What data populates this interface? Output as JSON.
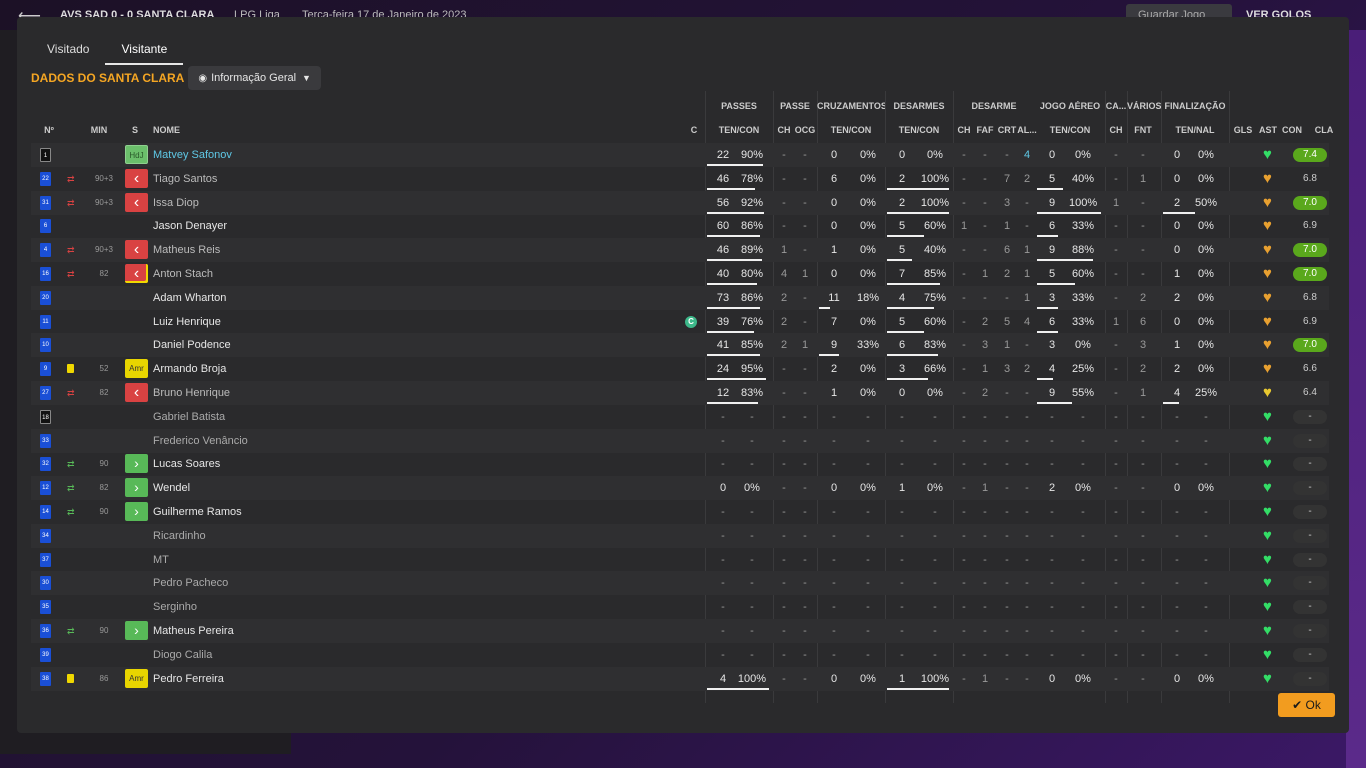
{
  "topbar": {
    "score": "AVS SAD 0 - 0 SANTA CLARA",
    "league": "LPG Liga",
    "date": "Terça-feira 17 de Janeiro de 2023",
    "save": "Guardar Jogo",
    "goals": "VER GOLOS"
  },
  "tabs": [
    {
      "label": "Visitado"
    },
    {
      "label": "Visitante"
    }
  ],
  "team_title": "DADOS DO SANTA CLARA",
  "view_dropdown": "Informação Geral",
  "ok_label": "Ok",
  "colors": {
    "accent": "#f5a623",
    "rating_good": "#5aa81c",
    "heart_green": "#33dd66",
    "heart_orange": "#e8a030",
    "sub_out": "#d94242",
    "sub_in": "#58b958"
  },
  "group_headers": {
    "passes": "PASSES",
    "passe": "PASSE",
    "cruzamentos": "CRUZAMENTOS",
    "desarmes": "DESARMES",
    "desarme": "DESARME",
    "jogo_aereo": "JOGO AÉREO",
    "ca": "CA...",
    "varios": "VÁRIOS",
    "finalizacao": "FINALIZAÇÃO"
  },
  "col_headers": {
    "num": "Nº",
    "min": "MIN",
    "s": "S",
    "nome": "NOME",
    "c": "C",
    "p_tc": "TEN/CON",
    "pa_ch": "CH",
    "pa_ocg": "OCG",
    "cr_tc": "TEN/CON",
    "de_tc": "TEN/CON",
    "d_ch": "CH",
    "d_faf": "FAF",
    "d_crt": "CRT",
    "d_al": "AL...",
    "ja_tc": "TEN/CON",
    "ca_ch": "CH",
    "va_fnt": "FNT",
    "fi_tn": "TEN/NAL",
    "gls": "GLS",
    "ast": "AST",
    "con": "CON",
    "cla": "CLA"
  },
  "players": [
    {
      "num": "1",
      "gk": true,
      "min": "",
      "sub": "",
      "pos": "HdJ",
      "name": "Matvey Safonov",
      "state": "active",
      "card": false,
      "captain": false,
      "p_t": "22",
      "p_c": "90%",
      "p_bar": 0.9,
      "pa_ch": "-",
      "pa_ocg": "-",
      "cr_t": "0",
      "cr_c": "0%",
      "cr_bar": 0,
      "de_t": "0",
      "de_c": "0%",
      "de_bar": 0,
      "d_ch": "-",
      "d_faf": "-",
      "d_crt": "-",
      "d_al": "4",
      "ja_t": "0",
      "ja_c": "0%",
      "ja_bar": 0,
      "ca_ch": "-",
      "va_fnt": "-",
      "fi_t": "0",
      "fi_c": "0%",
      "fi_bar": 0,
      "gls": "-",
      "ast": "",
      "heart": "green",
      "rating": "7.4",
      "rating_good": true
    },
    {
      "num": "22",
      "gk": false,
      "min": "90+3",
      "sub": "out",
      "pos": "out",
      "name": "Tiago Santos",
      "state": "sub",
      "card": false,
      "captain": false,
      "p_t": "46",
      "p_c": "78%",
      "p_bar": 0.78,
      "pa_ch": "-",
      "pa_ocg": "-",
      "cr_t": "6",
      "cr_c": "0%",
      "cr_bar": 0,
      "de_t": "2",
      "de_c": "100%",
      "de_bar": 1,
      "d_ch": "-",
      "d_faf": "-",
      "d_crt": "7",
      "d_al": "2",
      "ja_t": "5",
      "ja_c": "40%",
      "ja_bar": 0.4,
      "ca_ch": "-",
      "va_fnt": "1",
      "fi_t": "0",
      "fi_c": "0%",
      "fi_bar": 0,
      "gls": "-",
      "ast": "",
      "heart": "orange",
      "rating": "6.8",
      "rating_good": false
    },
    {
      "num": "31",
      "gk": false,
      "min": "90+3",
      "sub": "out",
      "pos": "out",
      "name": "Issa Diop",
      "state": "sub",
      "card": false,
      "captain": false,
      "p_t": "56",
      "p_c": "92%",
      "p_bar": 0.92,
      "pa_ch": "-",
      "pa_ocg": "-",
      "cr_t": "0",
      "cr_c": "0%",
      "cr_bar": 0,
      "de_t": "2",
      "de_c": "100%",
      "de_bar": 1,
      "d_ch": "-",
      "d_faf": "-",
      "d_crt": "3",
      "d_al": "-",
      "ja_t": "9",
      "ja_c": "100%",
      "ja_bar": 1,
      "ca_ch": "1",
      "va_fnt": "-",
      "fi_t": "2",
      "fi_c": "50%",
      "fi_bar": 0.5,
      "gls": "-",
      "ast": "",
      "heart": "orange",
      "rating": "7.0",
      "rating_good": true
    },
    {
      "num": "6",
      "gk": false,
      "min": "",
      "sub": "",
      "pos": "",
      "name": "Jason Denayer",
      "state": "normal",
      "card": false,
      "captain": false,
      "p_t": "60",
      "p_c": "86%",
      "p_bar": 0.86,
      "pa_ch": "-",
      "pa_ocg": "-",
      "cr_t": "0",
      "cr_c": "0%",
      "cr_bar": 0,
      "de_t": "5",
      "de_c": "60%",
      "de_bar": 0.6,
      "d_ch": "1",
      "d_faf": "-",
      "d_crt": "1",
      "d_al": "-",
      "ja_t": "6",
      "ja_c": "33%",
      "ja_bar": 0.33,
      "ca_ch": "-",
      "va_fnt": "-",
      "fi_t": "0",
      "fi_c": "0%",
      "fi_bar": 0,
      "gls": "-",
      "ast": "",
      "heart": "orange",
      "rating": "6.9",
      "rating_good": false
    },
    {
      "num": "4",
      "gk": false,
      "min": "90+3",
      "sub": "out",
      "pos": "out",
      "name": "Matheus Reis",
      "state": "sub",
      "card": false,
      "captain": false,
      "p_t": "46",
      "p_c": "89%",
      "p_bar": 0.89,
      "pa_ch": "1",
      "pa_ocg": "-",
      "cr_t": "1",
      "cr_c": "0%",
      "cr_bar": 0,
      "de_t": "5",
      "de_c": "40%",
      "de_bar": 0.4,
      "d_ch": "-",
      "d_faf": "-",
      "d_crt": "6",
      "d_al": "1",
      "ja_t": "9",
      "ja_c": "88%",
      "ja_bar": 0.88,
      "ca_ch": "-",
      "va_fnt": "-",
      "fi_t": "0",
      "fi_c": "0%",
      "fi_bar": 0,
      "gls": "-",
      "ast": "",
      "heart": "orange",
      "rating": "7.0",
      "rating_good": true
    },
    {
      "num": "16",
      "gk": false,
      "min": "82",
      "sub": "out",
      "pos": "out",
      "name": "Anton Stach",
      "state": "sub",
      "card": true,
      "captain": false,
      "p_t": "40",
      "p_c": "80%",
      "p_bar": 0.8,
      "pa_ch": "4",
      "pa_ocg": "1",
      "cr_t": "0",
      "cr_c": "0%",
      "cr_bar": 0,
      "de_t": "7",
      "de_c": "85%",
      "de_bar": 0.85,
      "d_ch": "-",
      "d_faf": "1",
      "d_crt": "2",
      "d_al": "1",
      "ja_t": "5",
      "ja_c": "60%",
      "ja_bar": 0.6,
      "ca_ch": "-",
      "va_fnt": "-",
      "fi_t": "1",
      "fi_c": "0%",
      "fi_bar": 0,
      "gls": "-",
      "ast": "",
      "heart": "orange",
      "rating": "7.0",
      "rating_good": true
    },
    {
      "num": "20",
      "gk": false,
      "min": "",
      "sub": "",
      "pos": "",
      "name": "Adam Wharton",
      "state": "normal",
      "card": false,
      "captain": false,
      "p_t": "73",
      "p_c": "86%",
      "p_bar": 0.86,
      "pa_ch": "2",
      "pa_ocg": "-",
      "cr_t": "11",
      "cr_c": "18%",
      "cr_bar": 0.18,
      "de_t": "4",
      "de_c": "75%",
      "de_bar": 0.75,
      "d_ch": "-",
      "d_faf": "-",
      "d_crt": "-",
      "d_al": "1",
      "ja_t": "3",
      "ja_c": "33%",
      "ja_bar": 0.33,
      "ca_ch": "-",
      "va_fnt": "2",
      "fi_t": "2",
      "fi_c": "0%",
      "fi_bar": 0,
      "gls": "-",
      "ast": "",
      "heart": "orange",
      "rating": "6.8",
      "rating_good": false
    },
    {
      "num": "11",
      "gk": false,
      "min": "",
      "sub": "",
      "pos": "",
      "name": "Luiz Henrique",
      "state": "normal",
      "card": false,
      "captain": true,
      "p_t": "39",
      "p_c": "76%",
      "p_bar": 0.76,
      "pa_ch": "2",
      "pa_ocg": "-",
      "cr_t": "7",
      "cr_c": "0%",
      "cr_bar": 0,
      "de_t": "5",
      "de_c": "60%",
      "de_bar": 0.6,
      "d_ch": "-",
      "d_faf": "2",
      "d_crt": "5",
      "d_al": "4",
      "ja_t": "6",
      "ja_c": "33%",
      "ja_bar": 0.33,
      "ca_ch": "1",
      "va_fnt": "6",
      "fi_t": "0",
      "fi_c": "0%",
      "fi_bar": 0,
      "gls": "-",
      "ast": "",
      "heart": "orange",
      "rating": "6.9",
      "rating_good": false
    },
    {
      "num": "10",
      "gk": false,
      "min": "",
      "sub": "",
      "pos": "",
      "name": "Daniel Podence",
      "state": "normal",
      "card": false,
      "captain": false,
      "p_t": "41",
      "p_c": "85%",
      "p_bar": 0.85,
      "pa_ch": "2",
      "pa_ocg": "1",
      "cr_t": "9",
      "cr_c": "33%",
      "cr_bar": 0.33,
      "de_t": "6",
      "de_c": "83%",
      "de_bar": 0.83,
      "d_ch": "-",
      "d_faf": "3",
      "d_crt": "1",
      "d_al": "-",
      "ja_t": "3",
      "ja_c": "0%",
      "ja_bar": 0,
      "ca_ch": "-",
      "va_fnt": "3",
      "fi_t": "1",
      "fi_c": "0%",
      "fi_bar": 0,
      "gls": "-",
      "ast": "",
      "heart": "orange",
      "rating": "7.0",
      "rating_good": true
    },
    {
      "num": "9",
      "gk": false,
      "min": "52",
      "sub": "card",
      "pos": "amr",
      "name": "Armando Broja",
      "state": "normal",
      "card": false,
      "captain": false,
      "p_t": "24",
      "p_c": "95%",
      "p_bar": 0.95,
      "pa_ch": "-",
      "pa_ocg": "-",
      "cr_t": "2",
      "cr_c": "0%",
      "cr_bar": 0,
      "de_t": "3",
      "de_c": "66%",
      "de_bar": 0.66,
      "d_ch": "-",
      "d_faf": "1",
      "d_crt": "3",
      "d_al": "2",
      "ja_t": "4",
      "ja_c": "25%",
      "ja_bar": 0.25,
      "ca_ch": "-",
      "va_fnt": "2",
      "fi_t": "2",
      "fi_c": "0%",
      "fi_bar": 0,
      "gls": "-",
      "ast": "",
      "heart": "orange",
      "rating": "6.6",
      "rating_good": false
    },
    {
      "num": "27",
      "gk": false,
      "min": "82",
      "sub": "out",
      "pos": "out",
      "name": "Bruno Henrique",
      "state": "sub",
      "card": false,
      "captain": false,
      "p_t": "12",
      "p_c": "83%",
      "p_bar": 0.83,
      "pa_ch": "-",
      "pa_ocg": "-",
      "cr_t": "1",
      "cr_c": "0%",
      "cr_bar": 0,
      "de_t": "0",
      "de_c": "0%",
      "de_bar": 0,
      "d_ch": "-",
      "d_faf": "2",
      "d_crt": "-",
      "d_al": "-",
      "ja_t": "9",
      "ja_c": "55%",
      "ja_bar": 0.55,
      "ca_ch": "-",
      "va_fnt": "1",
      "fi_t": "4",
      "fi_c": "25%",
      "fi_bar": 0.25,
      "gls": "-",
      "ast": "",
      "heart": "yellow",
      "rating": "6.4",
      "rating_good": false
    },
    {
      "num": "18",
      "gk": true,
      "min": "",
      "sub": "",
      "pos": "",
      "name": "Gabriel Batista",
      "state": "unused",
      "card": false,
      "captain": false,
      "p_t": "-",
      "p_c": "-",
      "p_bar": 0,
      "pa_ch": "-",
      "pa_ocg": "-",
      "cr_t": "-",
      "cr_c": "-",
      "cr_bar": 0,
      "de_t": "-",
      "de_c": "-",
      "de_bar": 0,
      "d_ch": "-",
      "d_faf": "-",
      "d_crt": "-",
      "d_al": "-",
      "ja_t": "-",
      "ja_c": "-",
      "ja_bar": 0,
      "ca_ch": "-",
      "va_fnt": "-",
      "fi_t": "-",
      "fi_c": "-",
      "fi_bar": 0,
      "gls": "-",
      "ast": "",
      "heart": "green",
      "rating": "-",
      "rating_good": false
    },
    {
      "num": "33",
      "gk": false,
      "min": "",
      "sub": "",
      "pos": "",
      "name": "Frederico Venâncio",
      "state": "unused",
      "card": false,
      "captain": false,
      "p_t": "-",
      "p_c": "-",
      "p_bar": 0,
      "pa_ch": "-",
      "pa_ocg": "-",
      "cr_t": "-",
      "cr_c": "-",
      "cr_bar": 0,
      "de_t": "-",
      "de_c": "-",
      "de_bar": 0,
      "d_ch": "-",
      "d_faf": "-",
      "d_crt": "-",
      "d_al": "-",
      "ja_t": "-",
      "ja_c": "-",
      "ja_bar": 0,
      "ca_ch": "-",
      "va_fnt": "-",
      "fi_t": "-",
      "fi_c": "-",
      "fi_bar": 0,
      "gls": "-",
      "ast": "",
      "heart": "green",
      "rating": "-",
      "rating_good": false
    },
    {
      "num": "32",
      "gk": false,
      "min": "90",
      "sub": "in",
      "pos": "in",
      "name": "Lucas Soares",
      "state": "normal",
      "card": false,
      "captain": false,
      "p_t": "-",
      "p_c": "-",
      "p_bar": 0,
      "pa_ch": "-",
      "pa_ocg": "-",
      "cr_t": "-",
      "cr_c": "-",
      "cr_bar": 0,
      "de_t": "-",
      "de_c": "-",
      "de_bar": 0,
      "d_ch": "-",
      "d_faf": "-",
      "d_crt": "-",
      "d_al": "-",
      "ja_t": "-",
      "ja_c": "-",
      "ja_bar": 0,
      "ca_ch": "-",
      "va_fnt": "-",
      "fi_t": "-",
      "fi_c": "-",
      "fi_bar": 0,
      "gls": "-",
      "ast": "",
      "heart": "green",
      "rating": "-",
      "rating_good": false
    },
    {
      "num": "12",
      "gk": false,
      "min": "82",
      "sub": "in",
      "pos": "in",
      "name": "Wendel",
      "state": "normal",
      "card": false,
      "captain": false,
      "p_t": "0",
      "p_c": "0%",
      "p_bar": 0,
      "pa_ch": "-",
      "pa_ocg": "-",
      "cr_t": "0",
      "cr_c": "0%",
      "cr_bar": 0,
      "de_t": "1",
      "de_c": "0%",
      "de_bar": 0,
      "d_ch": "-",
      "d_faf": "1",
      "d_crt": "-",
      "d_al": "-",
      "ja_t": "2",
      "ja_c": "0%",
      "ja_bar": 0,
      "ca_ch": "-",
      "va_fnt": "-",
      "fi_t": "0",
      "fi_c": "0%",
      "fi_bar": 0,
      "gls": "-",
      "ast": "",
      "heart": "green",
      "rating": "-",
      "rating_good": false
    },
    {
      "num": "14",
      "gk": false,
      "min": "90",
      "sub": "in",
      "pos": "in",
      "name": "Guilherme Ramos",
      "state": "normal",
      "card": false,
      "captain": false,
      "p_t": "-",
      "p_c": "-",
      "p_bar": 0,
      "pa_ch": "-",
      "pa_ocg": "-",
      "cr_t": "-",
      "cr_c": "-",
      "cr_bar": 0,
      "de_t": "-",
      "de_c": "-",
      "de_bar": 0,
      "d_ch": "-",
      "d_faf": "-",
      "d_crt": "-",
      "d_al": "-",
      "ja_t": "-",
      "ja_c": "-",
      "ja_bar": 0,
      "ca_ch": "-",
      "va_fnt": "-",
      "fi_t": "-",
      "fi_c": "-",
      "fi_bar": 0,
      "gls": "-",
      "ast": "",
      "heart": "green",
      "rating": "-",
      "rating_good": false
    },
    {
      "num": "34",
      "gk": false,
      "min": "",
      "sub": "",
      "pos": "",
      "name": "Ricardinho",
      "state": "unused",
      "card": false,
      "captain": false,
      "p_t": "-",
      "p_c": "-",
      "p_bar": 0,
      "pa_ch": "-",
      "pa_ocg": "-",
      "cr_t": "-",
      "cr_c": "-",
      "cr_bar": 0,
      "de_t": "-",
      "de_c": "-",
      "de_bar": 0,
      "d_ch": "-",
      "d_faf": "-",
      "d_crt": "-",
      "d_al": "-",
      "ja_t": "-",
      "ja_c": "-",
      "ja_bar": 0,
      "ca_ch": "-",
      "va_fnt": "-",
      "fi_t": "-",
      "fi_c": "-",
      "fi_bar": 0,
      "gls": "-",
      "ast": "",
      "heart": "green",
      "rating": "-",
      "rating_good": false
    },
    {
      "num": "37",
      "gk": false,
      "min": "",
      "sub": "",
      "pos": "",
      "name": "MT",
      "state": "unused",
      "card": false,
      "captain": false,
      "p_t": "-",
      "p_c": "-",
      "p_bar": 0,
      "pa_ch": "-",
      "pa_ocg": "-",
      "cr_t": "-",
      "cr_c": "-",
      "cr_bar": 0,
      "de_t": "-",
      "de_c": "-",
      "de_bar": 0,
      "d_ch": "-",
      "d_faf": "-",
      "d_crt": "-",
      "d_al": "-",
      "ja_t": "-",
      "ja_c": "-",
      "ja_bar": 0,
      "ca_ch": "-",
      "va_fnt": "-",
      "fi_t": "-",
      "fi_c": "-",
      "fi_bar": 0,
      "gls": "-",
      "ast": "",
      "heart": "green",
      "rating": "-",
      "rating_good": false
    },
    {
      "num": "30",
      "gk": false,
      "min": "",
      "sub": "",
      "pos": "",
      "name": "Pedro Pacheco",
      "state": "unused",
      "card": false,
      "captain": false,
      "p_t": "-",
      "p_c": "-",
      "p_bar": 0,
      "pa_ch": "-",
      "pa_ocg": "-",
      "cr_t": "-",
      "cr_c": "-",
      "cr_bar": 0,
      "de_t": "-",
      "de_c": "-",
      "de_bar": 0,
      "d_ch": "-",
      "d_faf": "-",
      "d_crt": "-",
      "d_al": "-",
      "ja_t": "-",
      "ja_c": "-",
      "ja_bar": 0,
      "ca_ch": "-",
      "va_fnt": "-",
      "fi_t": "-",
      "fi_c": "-",
      "fi_bar": 0,
      "gls": "-",
      "ast": "",
      "heart": "green",
      "rating": "-",
      "rating_good": false
    },
    {
      "num": "35",
      "gk": false,
      "min": "",
      "sub": "",
      "pos": "",
      "name": "Serginho",
      "state": "unused",
      "card": false,
      "captain": false,
      "p_t": "-",
      "p_c": "-",
      "p_bar": 0,
      "pa_ch": "-",
      "pa_ocg": "-",
      "cr_t": "-",
      "cr_c": "-",
      "cr_bar": 0,
      "de_t": "-",
      "de_c": "-",
      "de_bar": 0,
      "d_ch": "-",
      "d_faf": "-",
      "d_crt": "-",
      "d_al": "-",
      "ja_t": "-",
      "ja_c": "-",
      "ja_bar": 0,
      "ca_ch": "-",
      "va_fnt": "-",
      "fi_t": "-",
      "fi_c": "-",
      "fi_bar": 0,
      "gls": "-",
      "ast": "",
      "heart": "green",
      "rating": "-",
      "rating_good": false
    },
    {
      "num": "36",
      "gk": false,
      "min": "90",
      "sub": "in",
      "pos": "in",
      "name": "Matheus Pereira",
      "state": "normal",
      "card": false,
      "captain": false,
      "p_t": "-",
      "p_c": "-",
      "p_bar": 0,
      "pa_ch": "-",
      "pa_ocg": "-",
      "cr_t": "-",
      "cr_c": "-",
      "cr_bar": 0,
      "de_t": "-",
      "de_c": "-",
      "de_bar": 0,
      "d_ch": "-",
      "d_faf": "-",
      "d_crt": "-",
      "d_al": "-",
      "ja_t": "-",
      "ja_c": "-",
      "ja_bar": 0,
      "ca_ch": "-",
      "va_fnt": "-",
      "fi_t": "-",
      "fi_c": "-",
      "fi_bar": 0,
      "gls": "-",
      "ast": "",
      "heart": "green",
      "rating": "-",
      "rating_good": false
    },
    {
      "num": "39",
      "gk": false,
      "min": "",
      "sub": "",
      "pos": "",
      "name": "Diogo Calila",
      "state": "unused",
      "card": false,
      "captain": false,
      "p_t": "-",
      "p_c": "-",
      "p_bar": 0,
      "pa_ch": "-",
      "pa_ocg": "-",
      "cr_t": "-",
      "cr_c": "-",
      "cr_bar": 0,
      "de_t": "-",
      "de_c": "-",
      "de_bar": 0,
      "d_ch": "-",
      "d_faf": "-",
      "d_crt": "-",
      "d_al": "-",
      "ja_t": "-",
      "ja_c": "-",
      "ja_bar": 0,
      "ca_ch": "-",
      "va_fnt": "-",
      "fi_t": "-",
      "fi_c": "-",
      "fi_bar": 0,
      "gls": "-",
      "ast": "",
      "heart": "green",
      "rating": "-",
      "rating_good": false
    },
    {
      "num": "38",
      "gk": false,
      "min": "86",
      "sub": "card",
      "pos": "amr",
      "name": "Pedro Ferreira",
      "state": "normal",
      "card": false,
      "captain": false,
      "p_t": "4",
      "p_c": "100%",
      "p_bar": 1,
      "pa_ch": "-",
      "pa_ocg": "-",
      "cr_t": "0",
      "cr_c": "0%",
      "cr_bar": 0,
      "de_t": "1",
      "de_c": "100%",
      "de_bar": 1,
      "d_ch": "-",
      "d_faf": "1",
      "d_crt": "-",
      "d_al": "-",
      "ja_t": "0",
      "ja_c": "0%",
      "ja_bar": 0,
      "ca_ch": "-",
      "va_fnt": "-",
      "fi_t": "0",
      "fi_c": "0%",
      "fi_bar": 0,
      "gls": "-",
      "ast": "",
      "heart": "green",
      "rating": "-",
      "rating_good": false
    }
  ],
  "pos_labels": {
    "gk": "HdJ",
    "amr": "Amr",
    "out": "‹",
    "in": "›"
  }
}
